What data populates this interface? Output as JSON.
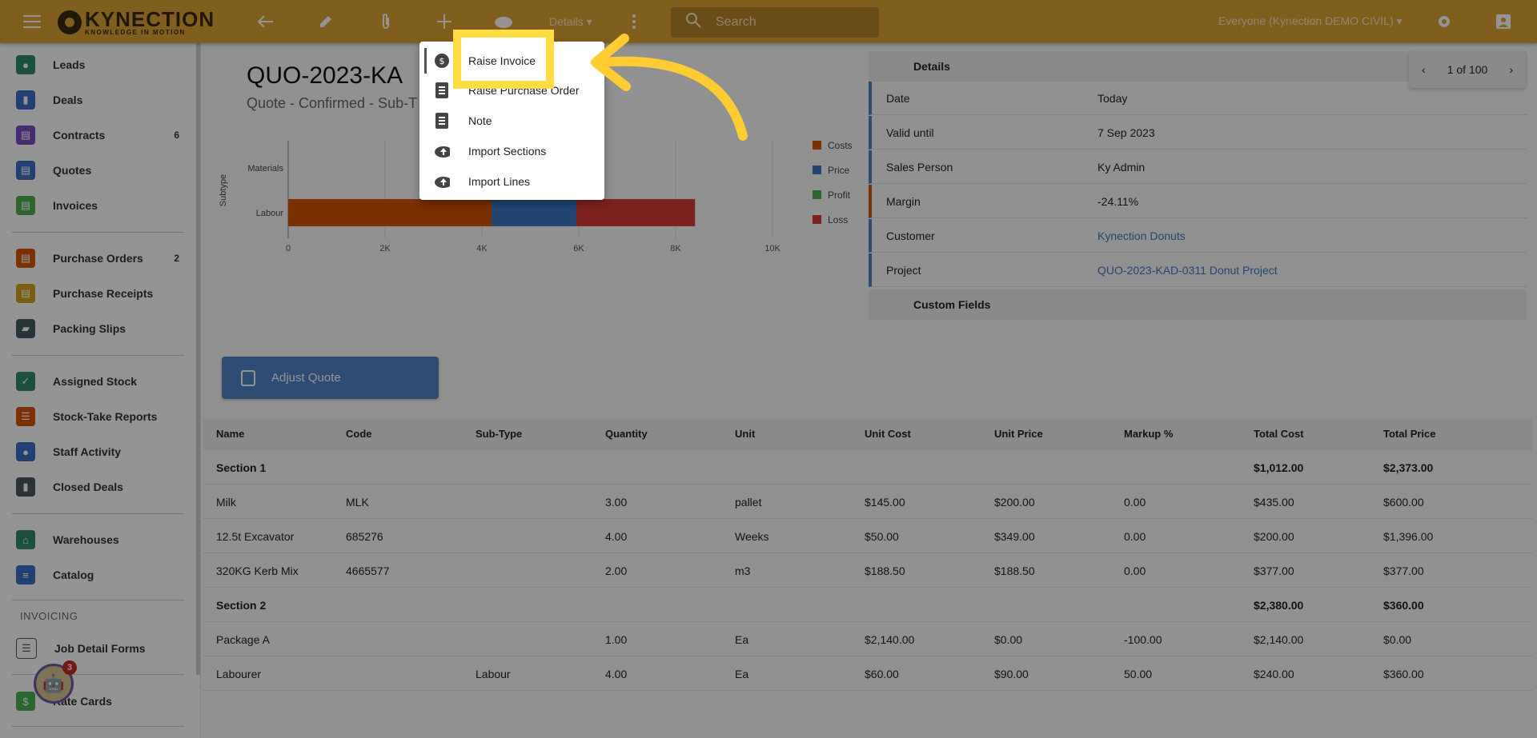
{
  "topbar": {
    "logo_title": "KYNECTION",
    "logo_subtitle": "KNOWLEDGE IN MOTION",
    "details_label": "Details ▾",
    "search_placeholder": "Search",
    "org_label": "Everyone (Kynection DEMO CIVIL) ▾"
  },
  "sidebar": {
    "items": [
      {
        "label": "Leads",
        "count": ""
      },
      {
        "label": "Deals",
        "count": ""
      },
      {
        "label": "Contracts",
        "count": "6"
      },
      {
        "label": "Quotes",
        "count": ""
      },
      {
        "label": "Invoices",
        "count": ""
      },
      {
        "label": "Purchase Orders",
        "count": "2"
      },
      {
        "label": "Purchase Receipts",
        "count": ""
      },
      {
        "label": "Packing Slips",
        "count": ""
      },
      {
        "label": "Assigned Stock",
        "count": ""
      },
      {
        "label": "Stock-Take Reports",
        "count": ""
      },
      {
        "label": "Staff Activity",
        "count": ""
      },
      {
        "label": "Closed Deals",
        "count": ""
      },
      {
        "label": "Warehouses",
        "count": ""
      },
      {
        "label": "Catalog",
        "count": ""
      },
      {
        "label": "Job Detail Forms",
        "count": ""
      },
      {
        "label": "Rate Cards",
        "count": ""
      }
    ],
    "section_invoicing": "INVOICING",
    "avatar_badge": "3"
  },
  "main": {
    "title": "QUO-2023-KA",
    "subtitle": "Quote - Confirmed - Sub-T",
    "adjust_button": "Adjust Quote"
  },
  "chart_data": {
    "type": "bar",
    "orientation": "horizontal",
    "stacked": true,
    "categories": [
      "Materials",
      "Labour"
    ],
    "ylabel": "Subtype",
    "xlim": [
      0,
      10000
    ],
    "xticks": [
      "0",
      "2K",
      "4K",
      "6K",
      "8K",
      "10K"
    ],
    "series": [
      {
        "name": "Costs",
        "color": "#d35400",
        "values": [
          0,
          4200
        ]
      },
      {
        "name": "Price",
        "color": "#3c78c4",
        "values": [
          0,
          1750
        ]
      },
      {
        "name": "Profit",
        "color": "#4caf50",
        "values": [
          0,
          0
        ]
      },
      {
        "name": "Loss",
        "color": "#d83a3a",
        "values": [
          0,
          2450
        ]
      }
    ],
    "legend": "right"
  },
  "details": {
    "heading": "Details",
    "rows": [
      {
        "key": "Date",
        "value": "Today",
        "link": false,
        "accent": "#4d84c4"
      },
      {
        "key": "Valid until",
        "value": "7 Sep 2023",
        "link": false,
        "accent": "#4d84c4"
      },
      {
        "key": "Sales Person",
        "value": "Ky Admin",
        "link": false,
        "accent": "#4d84c4"
      },
      {
        "key": "Margin",
        "value": "-24.11%",
        "link": false,
        "accent": "#d35400"
      },
      {
        "key": "Customer",
        "value": "Kynection Donuts",
        "link": true,
        "accent": "#4d84c4"
      },
      {
        "key": "Project",
        "value": "QUO-2023-KAD-0311 Donut Project",
        "link": true,
        "accent": "#4d84c4"
      }
    ],
    "custom_fields": "Custom Fields",
    "pager": "1 of 100"
  },
  "table": {
    "headers": [
      "Name",
      "Code",
      "Sub-Type",
      "Quantity",
      "Unit",
      "Unit Cost",
      "Unit Price",
      "Markup %",
      "Total Cost",
      "Total Price"
    ],
    "rows": [
      {
        "section": true,
        "cells": [
          "Section 1",
          "",
          "",
          "",
          "",
          "",
          "",
          "",
          "$1,012.00",
          "$2,373.00"
        ]
      },
      {
        "section": false,
        "cells": [
          "Milk",
          "MLK",
          "",
          "3.00",
          "pallet",
          "$145.00",
          "$200.00",
          "0.00",
          "$435.00",
          "$600.00"
        ]
      },
      {
        "section": false,
        "cells": [
          "12.5t Excavator",
          "685276",
          "",
          "4.00",
          "Weeks",
          "$50.00",
          "$349.00",
          "0.00",
          "$200.00",
          "$1,396.00"
        ]
      },
      {
        "section": false,
        "cells": [
          "320KG Kerb Mix",
          "4665577",
          "",
          "2.00",
          "m3",
          "$188.50",
          "$188.50",
          "0.00",
          "$377.00",
          "$377.00"
        ]
      },
      {
        "section": true,
        "cells": [
          "Section 2",
          "",
          "",
          "",
          "",
          "",
          "",
          "",
          "$2,380.00",
          "$360.00"
        ]
      },
      {
        "section": false,
        "cells": [
          "Package A",
          "",
          "",
          "1.00",
          "Ea",
          "$2,140.00",
          "$0.00",
          "-100.00",
          "$2,140.00",
          "$0.00"
        ]
      },
      {
        "section": false,
        "cells": [
          "Labourer",
          "",
          "Labour",
          "4.00",
          "Ea",
          "$60.00",
          "$90.00",
          "50.00",
          "$240.00",
          "$360.00"
        ]
      }
    ]
  },
  "dropdown": {
    "items": [
      {
        "label": "Raise Invoice",
        "icon": "dollar-icon"
      },
      {
        "label": "Raise Purchase Order",
        "icon": "notebook-icon"
      },
      {
        "label": "Note",
        "icon": "notebook-icon"
      },
      {
        "label": "Import Sections",
        "icon": "cloud-upload-icon"
      },
      {
        "label": "Import Lines",
        "icon": "cloud-upload-icon"
      }
    ]
  },
  "callout": {
    "highlight_color": "#ffdd42"
  }
}
